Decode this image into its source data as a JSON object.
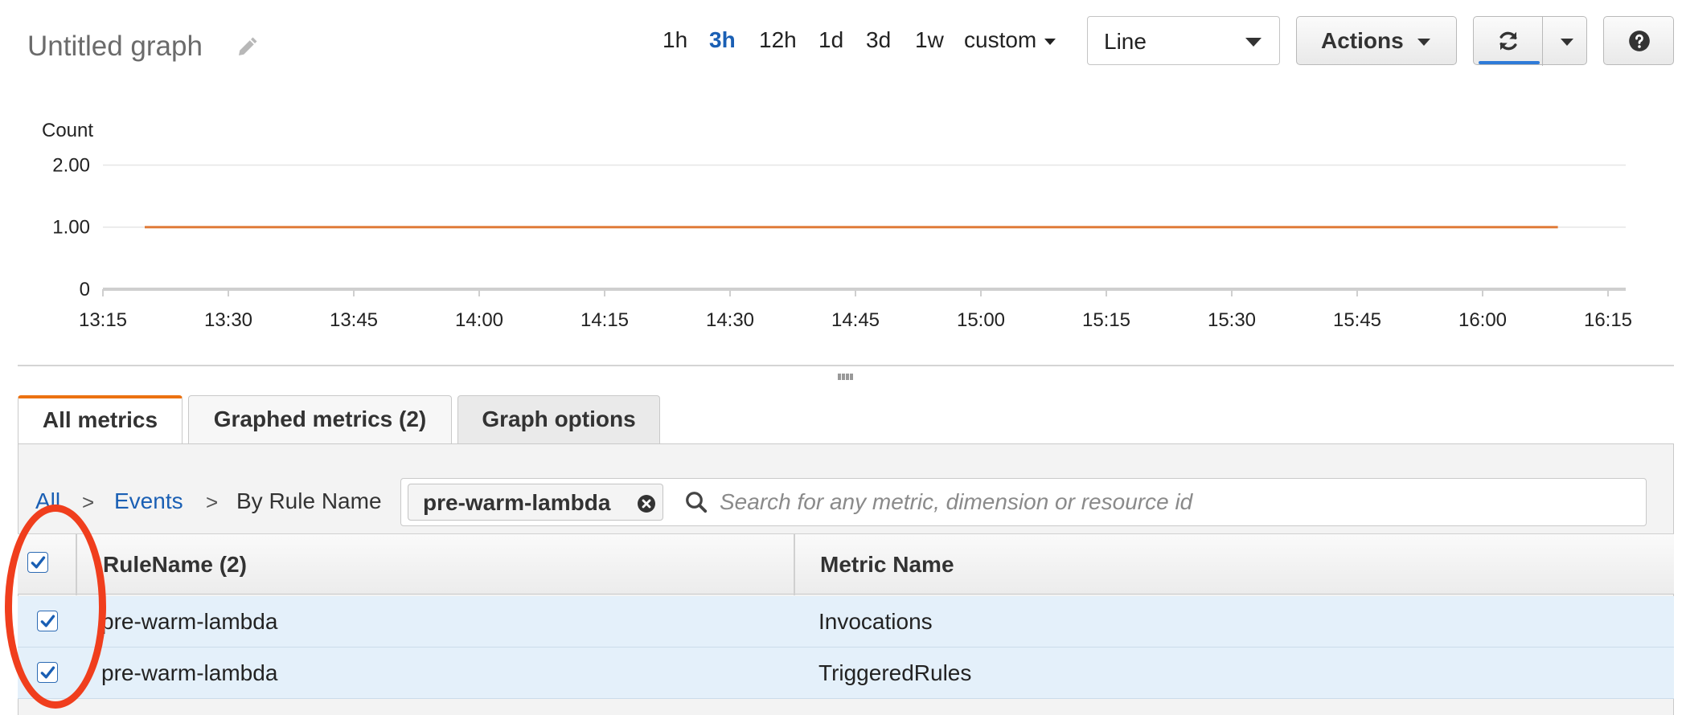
{
  "header": {
    "title": "Untitled graph",
    "time_ranges": [
      {
        "label": "1h",
        "active": false
      },
      {
        "label": "3h",
        "active": true
      },
      {
        "label": "12h",
        "active": false
      },
      {
        "label": "1d",
        "active": false
      },
      {
        "label": "3d",
        "active": false
      },
      {
        "label": "1w",
        "active": false
      }
    ],
    "custom_label": "custom",
    "graph_type": "Line",
    "actions_label": "Actions"
  },
  "chart_data": {
    "type": "line",
    "ylabel": "Count",
    "y_ticks": [
      {
        "value": 0,
        "label": "0"
      },
      {
        "value": 1,
        "label": "1.00"
      },
      {
        "value": 2,
        "label": "2.00"
      }
    ],
    "ylim": [
      0,
      2.2
    ],
    "x_ticks": [
      "13:15",
      "13:30",
      "13:45",
      "14:00",
      "14:15",
      "14:30",
      "14:45",
      "15:00",
      "15:15",
      "15:30",
      "15:45",
      "16:00",
      "16:15"
    ],
    "xlim": [
      "13:15",
      "16:15"
    ],
    "grid": true,
    "series": [
      {
        "color": "#e07b39",
        "x": [
          "13:20",
          "16:09"
        ],
        "y": [
          1,
          1
        ]
      }
    ]
  },
  "tabs": [
    {
      "label": "All metrics",
      "active": true
    },
    {
      "label": "Graphed metrics (2)",
      "active": false
    },
    {
      "label": "Graph options",
      "active": false
    }
  ],
  "breadcrumb": {
    "all": "All",
    "events": "Events",
    "current": "By Rule Name",
    "separator": ">"
  },
  "search": {
    "token": "pre-warm-lambda",
    "placeholder": "Search for any metric, dimension or resource id",
    "value": ""
  },
  "table": {
    "columns": [
      "RuleName (2)",
      "Metric Name"
    ],
    "rows": [
      {
        "rule": "pre-warm-lambda",
        "metric": "Invocations",
        "checked": true
      },
      {
        "rule": "pre-warm-lambda",
        "metric": "TriggeredRules",
        "checked": true
      }
    ],
    "all_checked": true
  },
  "colors": {
    "accent": "#1a5fb4",
    "tab_highlight": "#ec7211",
    "series_line": "#e07b39",
    "annotation": "#f03e1d",
    "selected_row": "#e4f0fa"
  },
  "icons": [
    "pencil-icon",
    "refresh-icon",
    "help-icon",
    "search-icon",
    "close-circle-icon",
    "check-icon"
  ]
}
